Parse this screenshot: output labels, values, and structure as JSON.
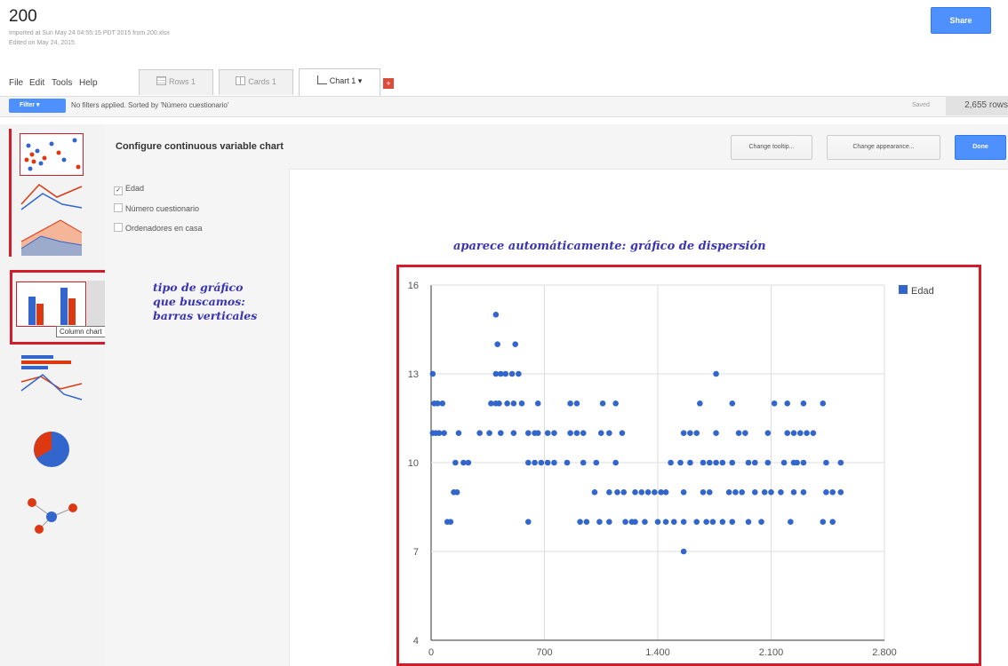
{
  "doc": {
    "title": "200",
    "imported_line": "Imported at Sun May 24 04:55:15 PDT 2015 from 200.xlsx",
    "edited_line": "Edited on May 24, 2015",
    "share_label": "Share"
  },
  "menu": [
    "File",
    "Edit",
    "Tools",
    "Help"
  ],
  "tabs": [
    {
      "label": "Rows 1",
      "icon": "rows-icon"
    },
    {
      "label": "Cards 1",
      "icon": "cards-icon"
    },
    {
      "label": "Chart 1 ▾",
      "icon": "chart-icon"
    }
  ],
  "add_tab_label": "+",
  "filter": {
    "button_label": "Filter ▾",
    "status_text": "No filters applied. Sorted by 'Número cuestionario'",
    "saved_label": "Saved",
    "rows_label": "2,655 rows"
  },
  "config": {
    "title": "Configure continuous variable chart",
    "buttons": [
      "Change tooltip...",
      "Change appearance..."
    ],
    "done_label": "Done"
  },
  "variables": [
    {
      "label": "Edad",
      "checked": true
    },
    {
      "label": "Número cuestionario",
      "checked": false
    },
    {
      "label": "Ordenadores en casa",
      "checked": false
    }
  ],
  "chart_types": [
    "Scatter chart",
    "Line chart",
    "Area chart",
    "Column chart",
    "Bar chart",
    "Line chart",
    "Pie chart",
    "Network graph"
  ],
  "tooltip_text": "Column chart",
  "annotations": {
    "top": "aparece automáticamente: gráfico de dispersión",
    "left": [
      "tipo de gráfico",
      "que buscamos:",
      "barras verticales"
    ]
  },
  "colors": {
    "accent_blue": "#4d90fe",
    "series_blue": "#3366cc",
    "series_red": "#dc3912",
    "highlight_red": "#d21c2c",
    "annotation_blue": "#3a34b4"
  },
  "chart_data": {
    "type": "scatter",
    "xlim": [
      0,
      2800
    ],
    "ylim": [
      4,
      16
    ],
    "x_ticks": [
      "0",
      "700",
      "1.400",
      "2.100",
      "2.800"
    ],
    "y_ticks": [
      "4",
      "7",
      "10",
      "13",
      "16"
    ],
    "grid": true,
    "legend_position": "top-right",
    "series": [
      {
        "name": "Edad",
        "points": [
          [
            10,
            13
          ],
          [
            20,
            12
          ],
          [
            40,
            12
          ],
          [
            70,
            12
          ],
          [
            10,
            11
          ],
          [
            30,
            11
          ],
          [
            50,
            11
          ],
          [
            80,
            11
          ],
          [
            170,
            11
          ],
          [
            150,
            10
          ],
          [
            200,
            10
          ],
          [
            230,
            10
          ],
          [
            140,
            9
          ],
          [
            160,
            9
          ],
          [
            100,
            8
          ],
          [
            120,
            8
          ],
          [
            300,
            11
          ],
          [
            360,
            11
          ],
          [
            430,
            11
          ],
          [
            370,
            12
          ],
          [
            400,
            12
          ],
          [
            420,
            12
          ],
          [
            400,
            13
          ],
          [
            430,
            13
          ],
          [
            460,
            13
          ],
          [
            500,
            13
          ],
          [
            540,
            13
          ],
          [
            410,
            14
          ],
          [
            520,
            14
          ],
          [
            400,
            15
          ],
          [
            470,
            12
          ],
          [
            510,
            12
          ],
          [
            560,
            12
          ],
          [
            510,
            11
          ],
          [
            600,
            11
          ],
          [
            640,
            11
          ],
          [
            600,
            10
          ],
          [
            640,
            10
          ],
          [
            680,
            10
          ],
          [
            720,
            10
          ],
          [
            760,
            10
          ],
          [
            840,
            10
          ],
          [
            940,
            10
          ],
          [
            1020,
            10
          ],
          [
            1140,
            10
          ],
          [
            660,
            11
          ],
          [
            720,
            11
          ],
          [
            760,
            11
          ],
          [
            860,
            11
          ],
          [
            900,
            11
          ],
          [
            940,
            11
          ],
          [
            1050,
            11
          ],
          [
            1100,
            11
          ],
          [
            1180,
            11
          ],
          [
            660,
            12
          ],
          [
            860,
            12
          ],
          [
            900,
            12
          ],
          [
            1060,
            12
          ],
          [
            1140,
            12
          ],
          [
            1010,
            9
          ],
          [
            1100,
            9
          ],
          [
            1150,
            9
          ],
          [
            1190,
            9
          ],
          [
            1260,
            9
          ],
          [
            1300,
            9
          ],
          [
            1340,
            9
          ],
          [
            1380,
            9
          ],
          [
            1420,
            9
          ],
          [
            1450,
            9
          ],
          [
            1450,
            8
          ],
          [
            1320,
            8
          ],
          [
            1260,
            8
          ],
          [
            1240,
            8
          ],
          [
            1200,
            8
          ],
          [
            1100,
            8
          ],
          [
            1040,
            8
          ],
          [
            960,
            8
          ],
          [
            920,
            8
          ],
          [
            600,
            8
          ],
          [
            1400,
            8
          ],
          [
            1500,
            8
          ],
          [
            1560,
            8
          ],
          [
            1640,
            8
          ],
          [
            1700,
            8
          ],
          [
            1740,
            8
          ],
          [
            1800,
            8
          ],
          [
            1860,
            8
          ],
          [
            1960,
            8
          ],
          [
            2040,
            8
          ],
          [
            2220,
            8
          ],
          [
            2420,
            8
          ],
          [
            2480,
            8
          ],
          [
            1480,
            10
          ],
          [
            1540,
            10
          ],
          [
            1600,
            10
          ],
          [
            1680,
            10
          ],
          [
            1720,
            10
          ],
          [
            1760,
            10
          ],
          [
            1800,
            10
          ],
          [
            1860,
            10
          ],
          [
            1960,
            10
          ],
          [
            2000,
            10
          ],
          [
            2080,
            10
          ],
          [
            2180,
            10
          ],
          [
            2240,
            10
          ],
          [
            2260,
            10
          ],
          [
            2300,
            10
          ],
          [
            2440,
            10
          ],
          [
            2530,
            10
          ],
          [
            1560,
            11
          ],
          [
            1600,
            11
          ],
          [
            1640,
            11
          ],
          [
            1760,
            11
          ],
          [
            1900,
            11
          ],
          [
            1940,
            11
          ],
          [
            2080,
            11
          ],
          [
            2200,
            11
          ],
          [
            2240,
            11
          ],
          [
            2280,
            11
          ],
          [
            2320,
            11
          ],
          [
            2360,
            11
          ],
          [
            1860,
            12
          ],
          [
            1660,
            12
          ],
          [
            2120,
            12
          ],
          [
            2200,
            12
          ],
          [
            2300,
            12
          ],
          [
            2420,
            12
          ],
          [
            1560,
            9
          ],
          [
            1680,
            9
          ],
          [
            1720,
            9
          ],
          [
            1840,
            9
          ],
          [
            1880,
            9
          ],
          [
            1920,
            9
          ],
          [
            2000,
            9
          ],
          [
            2060,
            9
          ],
          [
            2100,
            9
          ],
          [
            2160,
            9
          ],
          [
            2240,
            9
          ],
          [
            2300,
            9
          ],
          [
            2440,
            9
          ],
          [
            2480,
            9
          ],
          [
            2530,
            9
          ],
          [
            1760,
            13
          ],
          [
            1560,
            7
          ]
        ]
      }
    ]
  }
}
